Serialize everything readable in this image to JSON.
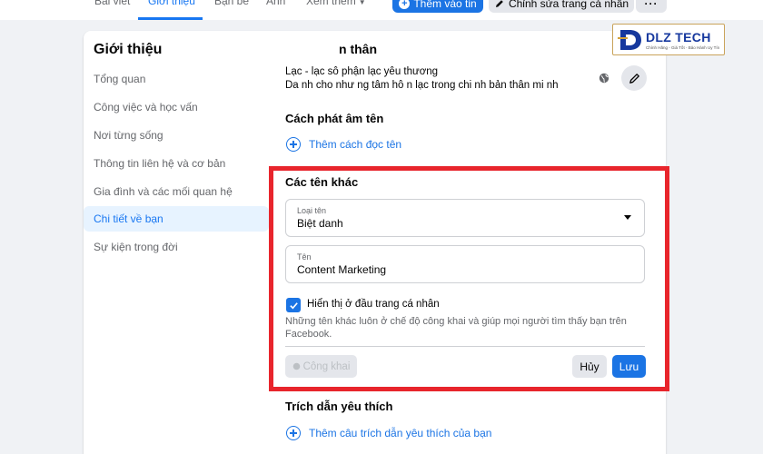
{
  "tabs": [
    {
      "label": "Bài viết"
    },
    {
      "label": "Giới thiệu"
    },
    {
      "label": "Bạn bè"
    },
    {
      "label": "Ảnh"
    },
    {
      "label": "Xem thêm"
    }
  ],
  "header_buttons": {
    "add_story": "Thêm vào tin",
    "edit_profile": "Chỉnh sửa trang cá nhân",
    "more": "···"
  },
  "sidebar": {
    "title": "Giới thiệu",
    "items": [
      {
        "label": "Tổng quan"
      },
      {
        "label": "Công việc và học vấn"
      },
      {
        "label": "Nơi từng sống"
      },
      {
        "label": "Thông tin liên hệ và cơ bản"
      },
      {
        "label": "Gia đình và các mối quan hệ"
      },
      {
        "label": "Chi tiết về bạn"
      },
      {
        "label": "Sự kiện trong đời"
      }
    ]
  },
  "main": {
    "partial_heading": "n thân",
    "about_line1": "Lạc - lạc sô  phận lạc yêu thương",
    "about_line2": "Da nh cho như ng tâm hô n lạc trong chi nh bản thân mi nh",
    "pronunciation_heading": "Cách phát âm tên",
    "add_pronunciation": "Thêm cách đọc tên",
    "other_names_heading": "Các tên khác",
    "name_type_label": "Loại tên",
    "name_type_value": "Biệt danh",
    "name_label": "Tên",
    "name_value": "Content Marketing",
    "show_on_top_label": "Hiển thị ở đầu trang cá nhân",
    "help_line1": "Những tên khác luôn ở chế độ công khai và giúp mọi người tìm thấy bạn trên",
    "help_line2": "Facebook.",
    "public_button": "Công khai",
    "cancel_button": "Hủy",
    "save_button": "Lưu",
    "quotes_heading": "Trích dẫn yêu thích",
    "add_quote": "Thêm câu trích dẫn yêu thích của bạn"
  },
  "logo": {
    "text": "DLZ TECH",
    "subtext": "Chính Hãng - Giá Tốt - Bảo Hành Uy Tín"
  },
  "colors": {
    "accent": "#1b74e4",
    "highlight_border": "#e8252c",
    "active_sidebar_bg": "#e7f3ff"
  },
  "state": {
    "show_on_top_checked": true,
    "active_tab": "Giới thiệu",
    "active_sidebar_item": "Chi tiết về bạn"
  }
}
